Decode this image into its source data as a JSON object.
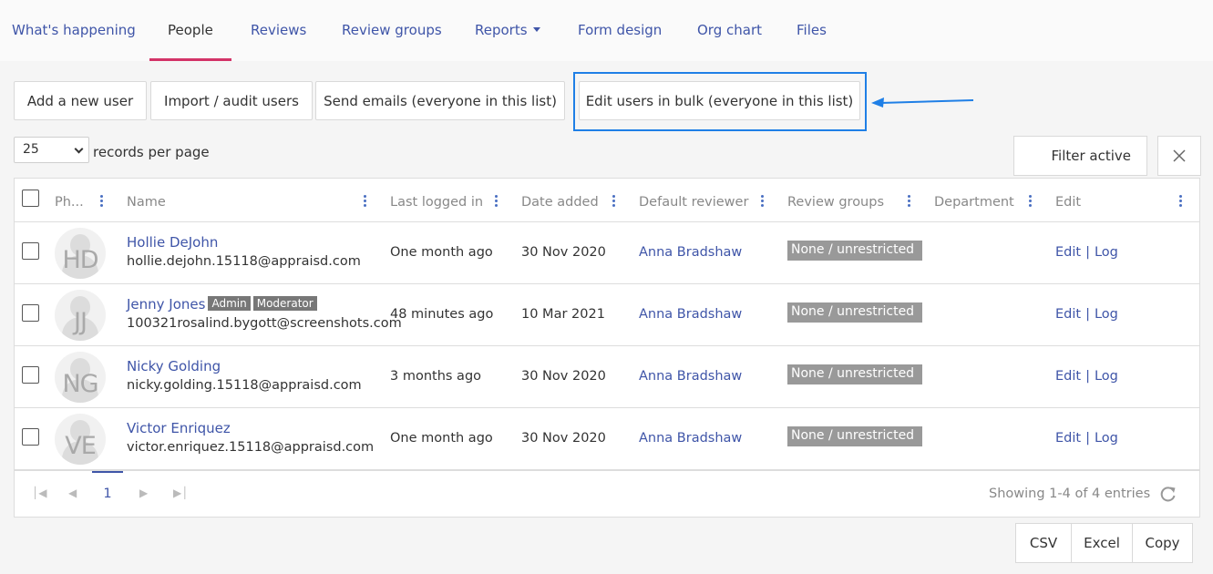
{
  "nav": {
    "items": [
      {
        "label": "What's happening"
      },
      {
        "label": "People"
      },
      {
        "label": "Reviews"
      },
      {
        "label": "Review groups"
      },
      {
        "label": "Reports"
      },
      {
        "label": "Form design"
      },
      {
        "label": "Org chart"
      },
      {
        "label": "Files"
      }
    ],
    "active": "People"
  },
  "actions": {
    "add_user": "Add a new user",
    "import_users": "Import / audit users",
    "send_emails": "Send emails (everyone in this list)",
    "edit_bulk": "Edit users in bulk (everyone in this list)"
  },
  "paging": {
    "per_page_value": "25",
    "per_page_label": "records per page"
  },
  "filter": {
    "label": "Filter active",
    "clear_icon": "close-icon"
  },
  "table": {
    "headers": {
      "photo": "Ph...",
      "name": "Name",
      "last_logged_in": "Last logged in",
      "date_added": "Date added",
      "default_reviewer": "Default reviewer",
      "review_groups": "Review groups",
      "department": "Department",
      "edit": "Edit"
    },
    "rows": [
      {
        "initials": "HD",
        "name": "Hollie DeJohn",
        "email": "hollie.dejohn.15118@appraisd.com",
        "last_logged_in": "One month ago",
        "date_added": "30 Nov 2020",
        "reviewer": "Anna Bradshaw",
        "group": "None / unrestricted",
        "badges": [],
        "edit": "Edit",
        "log": "Log",
        "sep": "|"
      },
      {
        "initials": "JJ",
        "name": "Jenny Jones",
        "email": "100321rosalind.bygott@screenshots.com",
        "last_logged_in": "48 minutes ago",
        "date_added": "10 Mar 2021",
        "reviewer": "Anna Bradshaw",
        "group": "None / unrestricted",
        "badges": [
          "Admin",
          "Moderator"
        ],
        "edit": "Edit",
        "log": "Log",
        "sep": "|"
      },
      {
        "initials": "NG",
        "name": "Nicky Golding",
        "email": "nicky.golding.15118@appraisd.com",
        "last_logged_in": "3 months ago",
        "date_added": "30 Nov 2020",
        "reviewer": "Anna Bradshaw",
        "group": "None / unrestricted",
        "badges": [],
        "edit": "Edit",
        "log": "Log",
        "sep": "|"
      },
      {
        "initials": "VE",
        "name": "Victor Enriquez",
        "email": "victor.enriquez.15118@appraisd.com",
        "last_logged_in": "One month ago",
        "date_added": "30 Nov 2020",
        "reviewer": "Anna Bradshaw",
        "group": "None / unrestricted",
        "badges": [],
        "edit": "Edit",
        "log": "Log",
        "sep": "|"
      }
    ]
  },
  "footer": {
    "current_page": "1",
    "showing": "Showing 1-4 of 4 entries"
  },
  "export": {
    "csv": "CSV",
    "excel": "Excel",
    "copy": "Copy"
  },
  "colors": {
    "link": "#3f55a8",
    "active_tab_underline": "#d33367",
    "highlight": "#1f7fe6",
    "tag_bg": "#999999"
  }
}
